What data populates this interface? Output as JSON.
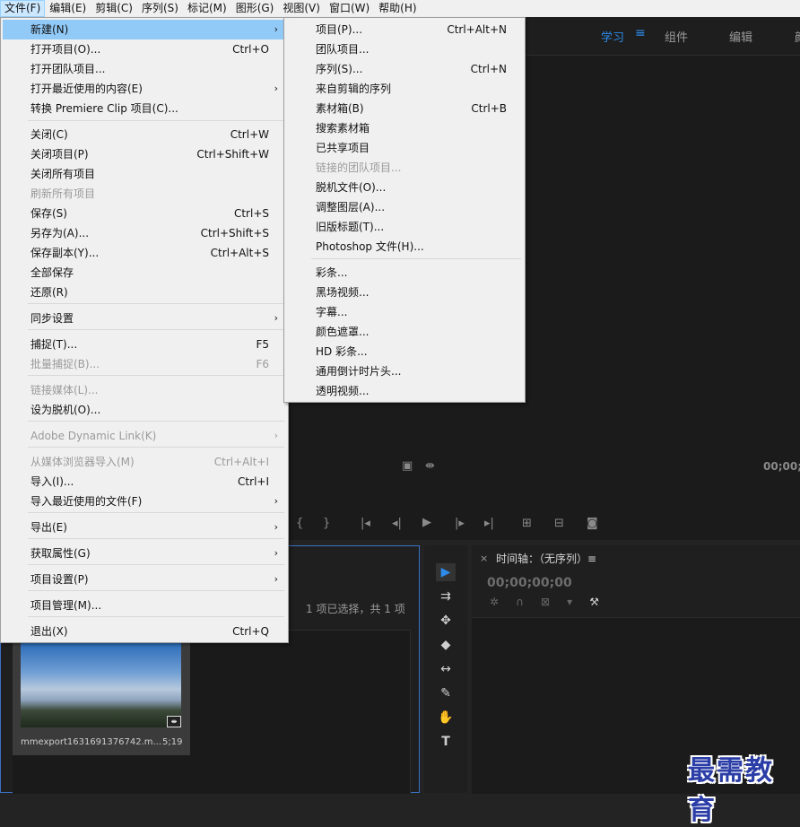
{
  "menubar": [
    "文件(F)",
    "编辑(E)",
    "剪辑(C)",
    "序列(S)",
    "标记(M)",
    "图形(G)",
    "视图(V)",
    "窗口(W)",
    "帮助(H)"
  ],
  "workspace": {
    "tabs": [
      "学习",
      "组件",
      "编辑",
      "颜"
    ]
  },
  "file_menu": [
    {
      "label": "新建(N)",
      "shortcut": "",
      "arrow": true,
      "state": "highlight"
    },
    {
      "label": "打开项目(O)...",
      "shortcut": "Ctrl+O",
      "arrow": false,
      "state": ""
    },
    {
      "label": "打开团队项目...",
      "shortcut": "",
      "arrow": false,
      "state": ""
    },
    {
      "label": "打开最近使用的内容(E)",
      "shortcut": "",
      "arrow": true,
      "state": ""
    },
    {
      "label": "转换 Premiere Clip 项目(C)...",
      "shortcut": "",
      "arrow": false,
      "state": ""
    },
    {
      "label": "关闭(C)",
      "shortcut": "Ctrl+W",
      "arrow": false,
      "state": ""
    },
    {
      "label": "关闭项目(P)",
      "shortcut": "Ctrl+Shift+W",
      "arrow": false,
      "state": ""
    },
    {
      "label": "关闭所有项目",
      "shortcut": "",
      "arrow": false,
      "state": ""
    },
    {
      "label": "刷新所有项目",
      "shortcut": "",
      "arrow": false,
      "state": "disabled"
    },
    {
      "label": "保存(S)",
      "shortcut": "Ctrl+S",
      "arrow": false,
      "state": ""
    },
    {
      "label": "另存为(A)...",
      "shortcut": "Ctrl+Shift+S",
      "arrow": false,
      "state": ""
    },
    {
      "label": "保存副本(Y)...",
      "shortcut": "Ctrl+Alt+S",
      "arrow": false,
      "state": ""
    },
    {
      "label": "全部保存",
      "shortcut": "",
      "arrow": false,
      "state": ""
    },
    {
      "label": "还原(R)",
      "shortcut": "",
      "arrow": false,
      "state": ""
    },
    {
      "label": "同步设置",
      "shortcut": "",
      "arrow": true,
      "state": ""
    },
    {
      "label": "捕捉(T)...",
      "shortcut": "F5",
      "arrow": false,
      "state": ""
    },
    {
      "label": "批量捕捉(B)...",
      "shortcut": "F6",
      "arrow": false,
      "state": "disabled"
    },
    {
      "label": "链接媒体(L)...",
      "shortcut": "",
      "arrow": false,
      "state": "disabled"
    },
    {
      "label": "设为脱机(O)...",
      "shortcut": "",
      "arrow": false,
      "state": ""
    },
    {
      "label": "Adobe Dynamic Link(K)",
      "shortcut": "",
      "arrow": true,
      "state": "disabled"
    },
    {
      "label": "从媒体浏览器导入(M)",
      "shortcut": "Ctrl+Alt+I",
      "arrow": false,
      "state": "disabled"
    },
    {
      "label": "导入(I)...",
      "shortcut": "Ctrl+I",
      "arrow": false,
      "state": ""
    },
    {
      "label": "导入最近使用的文件(F)",
      "shortcut": "",
      "arrow": true,
      "state": ""
    },
    {
      "label": "导出(E)",
      "shortcut": "",
      "arrow": true,
      "state": ""
    },
    {
      "label": "获取属性(G)",
      "shortcut": "",
      "arrow": true,
      "state": ""
    },
    {
      "label": "项目设置(P)",
      "shortcut": "",
      "arrow": true,
      "state": ""
    },
    {
      "label": "项目管理(M)...",
      "shortcut": "",
      "arrow": false,
      "state": ""
    },
    {
      "label": "退出(X)",
      "shortcut": "Ctrl+Q",
      "arrow": false,
      "state": ""
    }
  ],
  "new_submenu": [
    {
      "label": "项目(P)...",
      "shortcut": "Ctrl+Alt+N",
      "state": ""
    },
    {
      "label": "团队项目...",
      "shortcut": "",
      "state": ""
    },
    {
      "label": "序列(S)...",
      "shortcut": "Ctrl+N",
      "state": ""
    },
    {
      "label": "来自剪辑的序列",
      "shortcut": "",
      "state": ""
    },
    {
      "label": "素材箱(B)",
      "shortcut": "Ctrl+B",
      "state": ""
    },
    {
      "label": "搜索素材箱",
      "shortcut": "",
      "state": ""
    },
    {
      "label": "已共享项目",
      "shortcut": "",
      "state": ""
    },
    {
      "label": "链接的团队项目...",
      "shortcut": "",
      "state": "disabled"
    },
    {
      "label": "脱机文件(O)...",
      "shortcut": "",
      "state": ""
    },
    {
      "label": "调整图层(A)...",
      "shortcut": "",
      "state": ""
    },
    {
      "label": "旧版标题(T)...",
      "shortcut": "",
      "state": ""
    },
    {
      "label": "Photoshop 文件(H)...",
      "shortcut": "",
      "state": ""
    },
    {
      "label": "彩条...",
      "shortcut": "",
      "state": ""
    },
    {
      "label": "黑场视频...",
      "shortcut": "",
      "state": ""
    },
    {
      "label": "字幕...",
      "shortcut": "",
      "state": ""
    },
    {
      "label": "颜色遮罩...",
      "shortcut": "",
      "state": ""
    },
    {
      "label": "HD 彩条...",
      "shortcut": "",
      "state": ""
    },
    {
      "label": "通用倒计时片头...",
      "shortcut": "",
      "state": ""
    },
    {
      "label": "透明视频...",
      "shortcut": "",
      "state": ""
    }
  ],
  "program": {
    "timecode": "00;00;"
  },
  "project": {
    "status": "1 项已选择，共 1 项",
    "clip_name": "mmexport1631691376742.m...",
    "clip_duration": "5;19"
  },
  "timeline": {
    "close": "×",
    "title": "时间轴：（无序列）≡",
    "timecode": "00;00;00;00"
  },
  "watermark": "最需教育",
  "colors": {
    "accent": "#2d8ceb",
    "menu_highlight": "#91c9f7"
  }
}
